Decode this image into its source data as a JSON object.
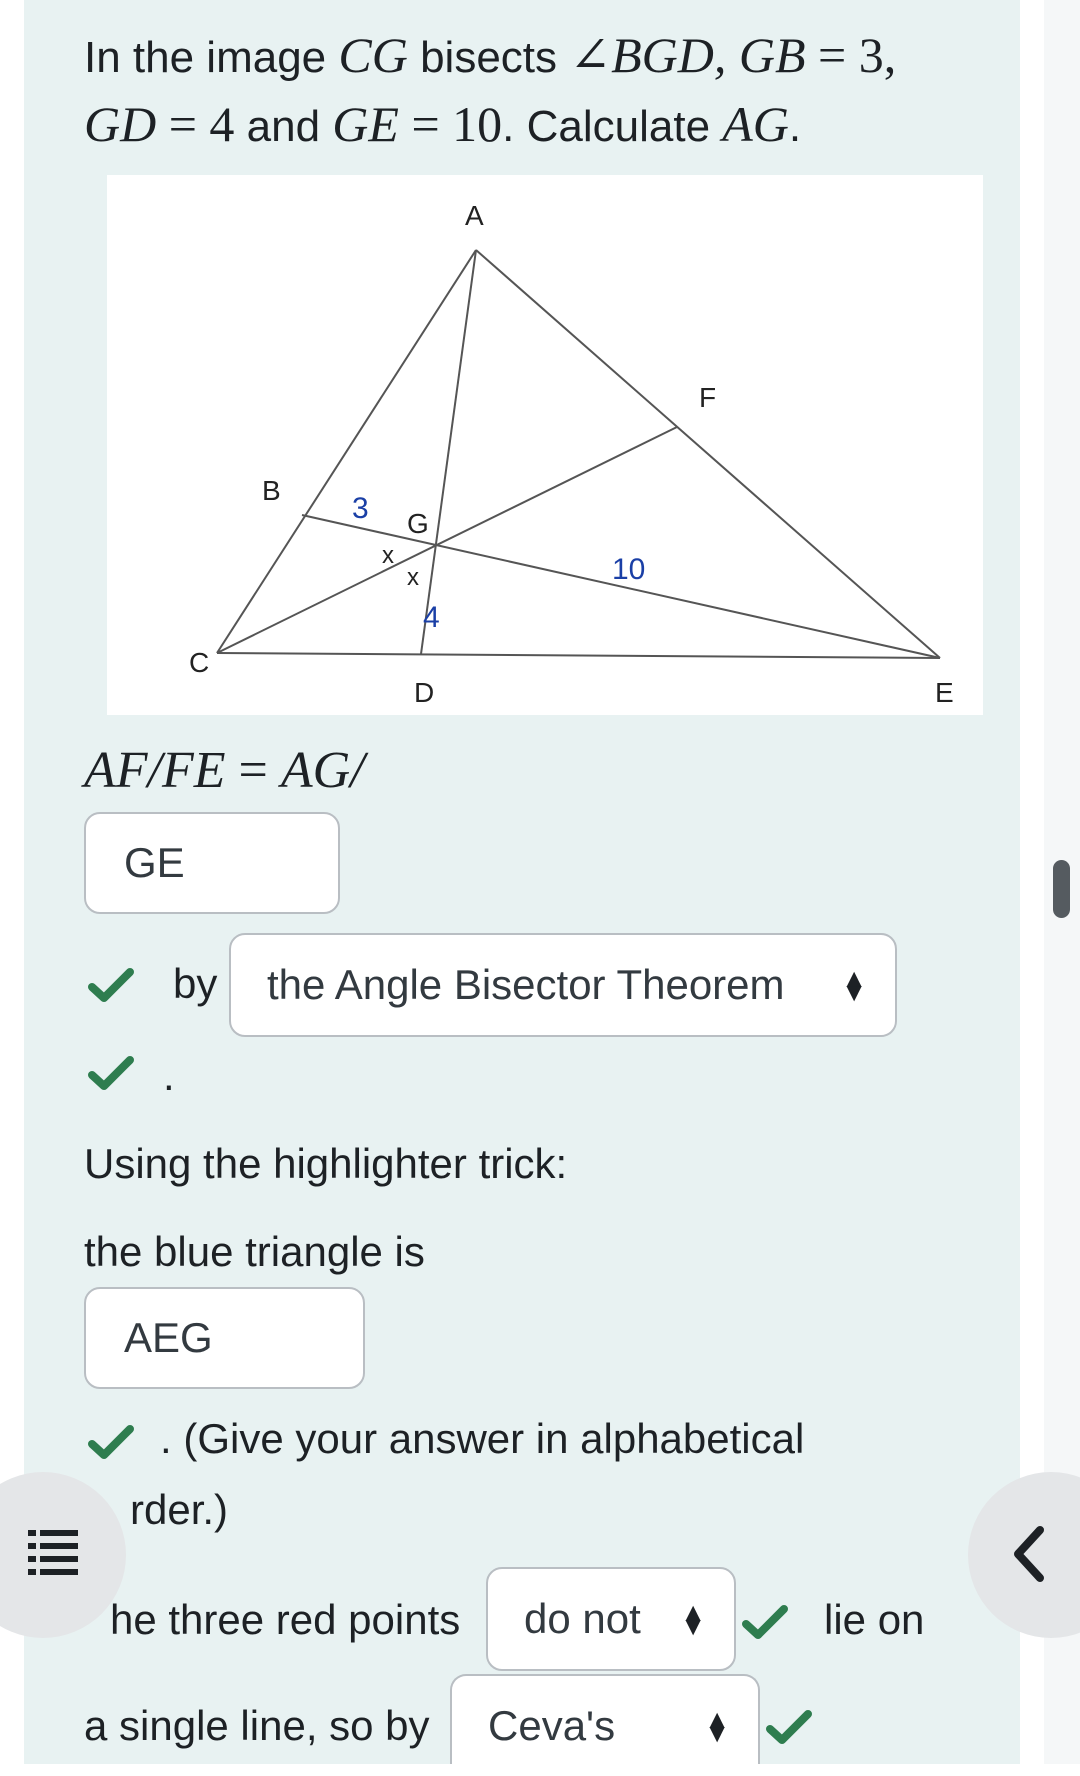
{
  "question": {
    "line1_text1": "In the image ",
    "line1_m1": "CG",
    "line1_text2": " bisects ",
    "line1_m2": "∠BGD, GB",
    "line1_eq1": " = 3,",
    "line2_m1": "GD",
    "line2_eq1": " = 4",
    "line2_text1": " and ",
    "line2_m2": "GE",
    "line2_eq2": " = 10",
    "line2_text2": ". Calculate ",
    "line2_m3": "AG",
    "line2_text3": "."
  },
  "figure": {
    "labels": {
      "A": "A",
      "B": "B",
      "C": "C",
      "D": "D",
      "E": "E",
      "F": "F",
      "G": "G",
      "gb": "3",
      "gd": "4",
      "ge": "10",
      "x1": "x",
      "x2": "x"
    }
  },
  "ratio": {
    "left": "AF/FE",
    "eq": " = ",
    "right": "AG/"
  },
  "answers": {
    "ratio_denominator": "GE",
    "by_label": "by",
    "theorem_select": "the Angle Bisector Theorem",
    "period": ".",
    "highlighter_text": "Using the highlighter trick:",
    "blue_triangle_text": "the blue triangle is",
    "blue_triangle_answer": "AEG",
    "alphabetical_line1": ". (Give your answer in alphabetical",
    "alphabetical_line2": "rder.)",
    "red_points_text": "he three red points",
    "red_points_select": "do not",
    "lie_on_text": "lie on",
    "single_line_text": "a single line, so by",
    "ceva_select": "Ceva's"
  },
  "icons": {
    "check": "check-icon",
    "select_arrow": "updown-arrow-icon",
    "menu": "list-menu-icon",
    "back": "chevron-left-icon"
  },
  "colors": {
    "panel_bg": "#e8f2f2",
    "check_green": "#2e7d4f",
    "diagram_blue": "#1a3fa6"
  }
}
